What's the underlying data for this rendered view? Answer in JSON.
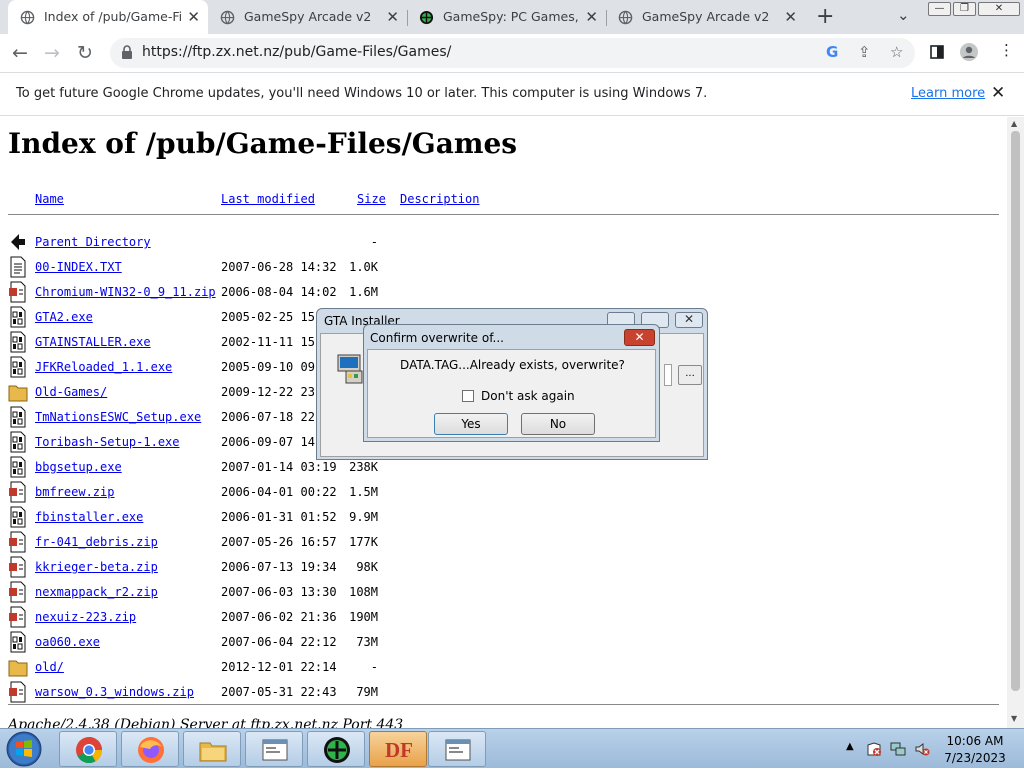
{
  "tabs": [
    {
      "title": "Index of /pub/Game-File",
      "active": true,
      "icon": "globe-icon"
    },
    {
      "title": "GameSpy Arcade v2",
      "active": false,
      "icon": "globe-icon"
    },
    {
      "title": "GameSpy: PC Games, Rev",
      "active": false,
      "icon": "gamespy-icon"
    },
    {
      "title": "GameSpy Arcade v2",
      "active": false,
      "icon": "globe-icon"
    }
  ],
  "toolbar": {
    "url": "https://ftp.zx.net.nz/pub/Game-Files/Games/"
  },
  "infobar": {
    "message": "To get future Google Chrome updates, you'll need Windows 10 or later. This computer is using Windows 7.",
    "link": "Learn more"
  },
  "page": {
    "title": "Index of /pub/Game-Files/Games",
    "headers": {
      "name": "Name",
      "modified": "Last modified",
      "size": "Size",
      "description": "Description"
    },
    "rows": [
      {
        "name": "Parent Directory",
        "date": "",
        "size": "-",
        "icon": "back-icon"
      },
      {
        "name": "00-INDEX.TXT",
        "date": "2007-06-28 14:32",
        "size": "1.0K",
        "icon": "text-file-icon"
      },
      {
        "name": "Chromium-WIN32-0_9_11.zip",
        "date": "2006-08-04 14:02",
        "size": "1.6M",
        "icon": "archive-icon"
      },
      {
        "name": "GTA2.exe",
        "date": "2005-02-25 15",
        "size": "",
        "icon": "binary-icon"
      },
      {
        "name": "GTAINSTALLER.exe",
        "date": "2002-11-11 15",
        "size": "",
        "icon": "binary-icon"
      },
      {
        "name": "JFKReloaded_1.1.exe",
        "date": "2005-09-10 09",
        "size": "",
        "icon": "binary-icon"
      },
      {
        "name": "Old-Games/",
        "date": "2009-12-22 23",
        "size": "",
        "icon": "folder-icon"
      },
      {
        "name": "TmNationsESWC_Setup.exe",
        "date": "2006-07-18 22",
        "size": "",
        "icon": "binary-icon"
      },
      {
        "name": "Toribash-Setup-1.exe",
        "date": "2006-09-07 14",
        "size": "",
        "icon": "binary-icon"
      },
      {
        "name": "bbgsetup.exe",
        "date": "2007-01-14 03:19",
        "size": "238K",
        "icon": "binary-icon"
      },
      {
        "name": "bmfreew.zip",
        "date": "2006-04-01 00:22",
        "size": "1.5M",
        "icon": "archive-icon"
      },
      {
        "name": "fbinstaller.exe",
        "date": "2006-01-31 01:52",
        "size": "9.9M",
        "icon": "binary-icon"
      },
      {
        "name": "fr-041_debris.zip",
        "date": "2007-05-26 16:57",
        "size": "177K",
        "icon": "archive-icon"
      },
      {
        "name": "kkrieger-beta.zip",
        "date": "2006-07-13 19:34",
        "size": "98K",
        "icon": "archive-icon"
      },
      {
        "name": "nexmappack_r2.zip",
        "date": "2007-06-03 13:30",
        "size": "108M",
        "icon": "archive-icon"
      },
      {
        "name": "nexuiz-223.zip",
        "date": "2007-06-02 21:36",
        "size": "190M",
        "icon": "archive-icon"
      },
      {
        "name": "oa060.exe",
        "date": "2007-06-04 22:12",
        "size": "73M",
        "icon": "binary-icon"
      },
      {
        "name": "old/",
        "date": "2012-12-01 22:14",
        "size": "-",
        "icon": "folder-icon"
      },
      {
        "name": "warsow_0.3_windows.zip",
        "date": "2007-05-31 22:43",
        "size": "79M",
        "icon": "archive-icon"
      }
    ],
    "footer": "Apache/2.4.38 (Debian) Server at ftp.zx.net.nz Port 443"
  },
  "installer": {
    "title": "GTA Installer",
    "browse_label": "..."
  },
  "dialog": {
    "title": "Confirm overwrite of...",
    "message": "DATA.TAG...Already exists, overwrite?",
    "checkbox_label": "Don't ask again",
    "checkbox_checked": false,
    "yes_label": "Yes",
    "no_label": "No"
  },
  "taskbar": {
    "apps": [
      "chrome-icon",
      "firefox-icon",
      "folder-icon",
      "window-icon",
      "gamespy-icon",
      "df-icon",
      "window-icon"
    ],
    "df_label": "DF",
    "time": "10:06 AM",
    "date": "7/23/2023"
  }
}
